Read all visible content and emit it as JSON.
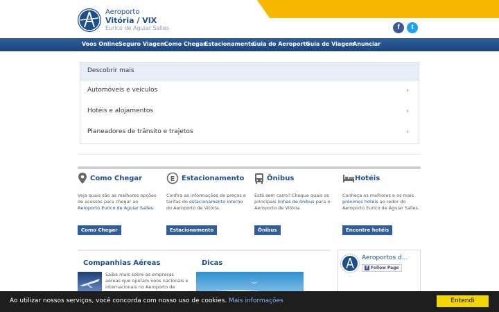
{
  "header": {
    "logo_line1": "Aeroporto",
    "logo_line2": "Vitória / VIX",
    "logo_line3": "Eurico de Aguiar Salles",
    "facebook_glyph": "f",
    "twitter_glyph": "t"
  },
  "nav": {
    "items": [
      "Voos Online",
      "Seguro Viagem",
      "Como Chegar",
      "Estacionamento",
      "Guia do Aeroporto",
      "Guia de Viagem",
      "Anunciar"
    ]
  },
  "discover": {
    "title": "Descobrir mais",
    "items": [
      "Automóveis e veículos",
      "Hotéis e alojamentos",
      "Planeadores de trânsito e trajetos"
    ]
  },
  "sections": [
    {
      "title": "Como Chegar",
      "text_before": "Veja quais são as melhores opções de acessos para chegar ao ",
      "link": "Aeroporto Eurico de Aguiar Salles",
      "text_after": ".",
      "button": "Como Chegar",
      "icon": "map-pin-icon"
    },
    {
      "title": "Estacionamento",
      "text_before": "Confira as informações de preços e tarifas do ",
      "link": "estacionamento interno",
      "text_after": " do Aeroporto de Vitória.",
      "button": "Estacionamento",
      "icon": "parking-icon"
    },
    {
      "title": "Ônibus",
      "text_before": "Está sem carro? Cheque quais as principais ",
      "link": "linhas de ônibus",
      "text_after": " para o Aeroporto de Vitória.",
      "button": "Ônibus",
      "icon": "bus-icon"
    },
    {
      "title": "Hotéis",
      "text_before": "Conheça os melhores e os mais ",
      "link": "próximos hotéis",
      "text_after": " ao redor do Aeroporto Eurico de Aguiar Salles.",
      "button": "Encontre hotéis",
      "icon": "bed-icon"
    }
  ],
  "airlines": {
    "title": "Companhias Aéreas",
    "text": "Saiba mais sobre as empresas aéreas que operam voos nacionais e internacionais no Aeroporto de Vitória."
  },
  "tips": {
    "title": "Dicas"
  },
  "facebook_widget": {
    "page_name": "Aeroportos d...",
    "follow_label": "Follow Page",
    "follow_glyph": "f"
  },
  "cookie": {
    "text": "Ao utilizar nossos serviços, você concorda com nosso uso de cookies. ",
    "link": "Mais informações",
    "button": "Entendi"
  }
}
